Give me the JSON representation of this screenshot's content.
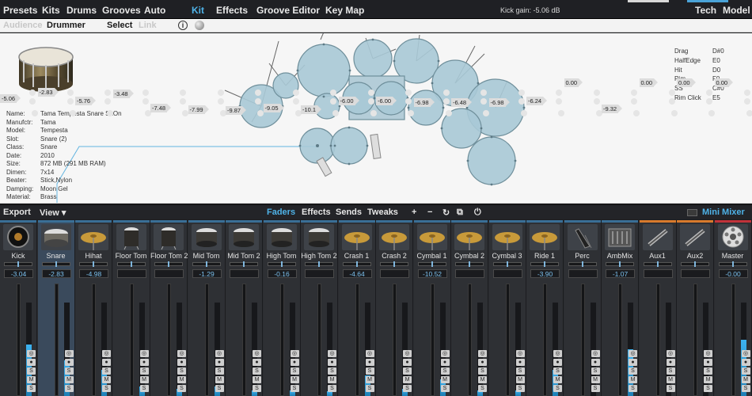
{
  "menu": {
    "items": [
      "Presets",
      "Kits",
      "Drums",
      "Grooves",
      "Auto",
      "Kit",
      "Effects",
      "Groove Editor",
      "Key Map"
    ],
    "active_index": 5,
    "kick_gain": "Kick gain: -5.06 dB",
    "right_items": [
      "Tech",
      "Model"
    ]
  },
  "subbar": {
    "audience": "Audience",
    "drummer": "Drummer",
    "select": "Select",
    "link": "Link",
    "info_icon": "i"
  },
  "instrument": {
    "fields": [
      {
        "k": "Name:",
        "v": "Tama Tempesta Snare SnOn"
      },
      {
        "k": "Manufctr:",
        "v": "Tama"
      },
      {
        "k": "Model:",
        "v": "Tempesta"
      },
      {
        "k": "Slot:",
        "v": "Snare (2)"
      },
      {
        "k": "Class:",
        "v": "Snare"
      },
      {
        "k": "Date:",
        "v": "2010"
      },
      {
        "k": "Size:",
        "v": "872 MB (291 MB RAM)"
      },
      {
        "k": "Dimen:",
        "v": "7x14"
      },
      {
        "k": "Beater:",
        "v": "Stick,Nylon"
      },
      {
        "k": "Damping:",
        "v": "Moon Gel"
      },
      {
        "k": "Material:",
        "v": "Brass"
      }
    ]
  },
  "articulations": [
    {
      "name": "Drag",
      "note": "D#0"
    },
    {
      "name": "HalfEdge",
      "note": "E0"
    },
    {
      "name": "Hit",
      "note": "D0"
    },
    {
      "name": "Rim",
      "note": "F0"
    },
    {
      "name": "SS",
      "note": "C#0"
    },
    {
      "name": "Rim Click",
      "note": "E5"
    }
  ],
  "mixer_bar": {
    "export": "Export",
    "view": "View ▾",
    "tabs": [
      "Faders",
      "Effects",
      "Sends",
      "Tweaks"
    ],
    "active_tab": 0,
    "tool_icons": [
      "+",
      "−",
      "↻",
      "⧉",
      "⏻"
    ],
    "mini_mixer": "Mini Mixer"
  },
  "channels": [
    {
      "name": "Kick",
      "vol": "-3.04",
      "fader": "-5.06",
      "icon": "kick-drum-icon",
      "kind": "kick",
      "level": 0.55
    },
    {
      "name": "Snare",
      "vol": "-2.83",
      "fader": "-2.83",
      "icon": "snare-drum-icon",
      "kind": "snare",
      "level": 0.38
    },
    {
      "name": "Hihat",
      "vol": "-4.98",
      "fader": "-5.76",
      "icon": "hihat-icon",
      "kind": "cymbal",
      "level": 0.28
    },
    {
      "name": "Floor Tom",
      "vol": "",
      "fader": "-3.48",
      "icon": "floor-tom-icon",
      "kind": "tom",
      "level": 0.1
    },
    {
      "name": "Floor Tom 2",
      "vol": "",
      "fader": "-7.48",
      "icon": "floor-tom-2-icon",
      "kind": "tom",
      "level": 0.08
    },
    {
      "name": "Mid Tom",
      "vol": "-1.29",
      "fader": "-7.99",
      "icon": "mid-tom-icon",
      "kind": "drum",
      "level": 0.1
    },
    {
      "name": "Mid Tom 2",
      "vol": "",
      "fader": "-9.87",
      "icon": "mid-tom-2-icon",
      "kind": "drum",
      "level": 0.06
    },
    {
      "name": "High Tom",
      "vol": "-0.16",
      "fader": "-9.05",
      "icon": "high-tom-icon",
      "kind": "drum",
      "level": 0.06
    },
    {
      "name": "High Tom 2",
      "vol": "",
      "fader": "-10.1",
      "icon": "high-tom-2-icon",
      "kind": "drum",
      "level": 0.05
    },
    {
      "name": "Crash 1",
      "vol": "-4.64",
      "fader": "-6.00",
      "icon": "crash-1-icon",
      "kind": "cymbal",
      "level": 0.22
    },
    {
      "name": "Crash 2",
      "vol": "",
      "fader": "-6.00",
      "icon": "crash-2-icon",
      "kind": "cymbal",
      "level": 0.08
    },
    {
      "name": "Cymbal 1",
      "vol": "-10.52",
      "fader": "-6.98",
      "icon": "cymbal-1-icon",
      "kind": "cymbal",
      "level": 0.18
    },
    {
      "name": "Cymbal 2",
      "vol": "",
      "fader": "-6.48",
      "icon": "cymbal-2-icon",
      "kind": "cymbal",
      "level": 0.06
    },
    {
      "name": "Cymbal 3",
      "vol": "",
      "fader": "-6.98",
      "icon": "cymbal-3-icon",
      "kind": "cymbal",
      "level": 0.06
    },
    {
      "name": "Ride 1",
      "vol": "-3.90",
      "fader": "-6.24",
      "icon": "ride-1-icon",
      "kind": "cymbal",
      "level": 0.28
    },
    {
      "name": "Perc",
      "vol": "",
      "fader": "0.00",
      "icon": "percussion-icon",
      "kind": "perc",
      "level": 0.0
    },
    {
      "name": "AmbMix",
      "vol": "-1.07",
      "fader": "-9.32",
      "icon": "ambience-mixer-icon",
      "kind": "amb",
      "level": 0.5
    },
    {
      "name": "Aux1",
      "vol": "",
      "fader": "0.00",
      "icon": "aux-1-icon",
      "kind": "aux",
      "level": 0.0
    },
    {
      "name": "Aux2",
      "vol": "",
      "fader": "0.00",
      "icon": "aux-2-icon",
      "kind": "aux",
      "level": 0.0
    },
    {
      "name": "Master",
      "vol": "-0.00",
      "fader": "0.00",
      "icon": "master-icon",
      "kind": "master",
      "level": 0.6
    }
  ],
  "selected_channel": 1,
  "strip_buttons": [
    "◎",
    "●",
    "S",
    "M",
    "S"
  ]
}
